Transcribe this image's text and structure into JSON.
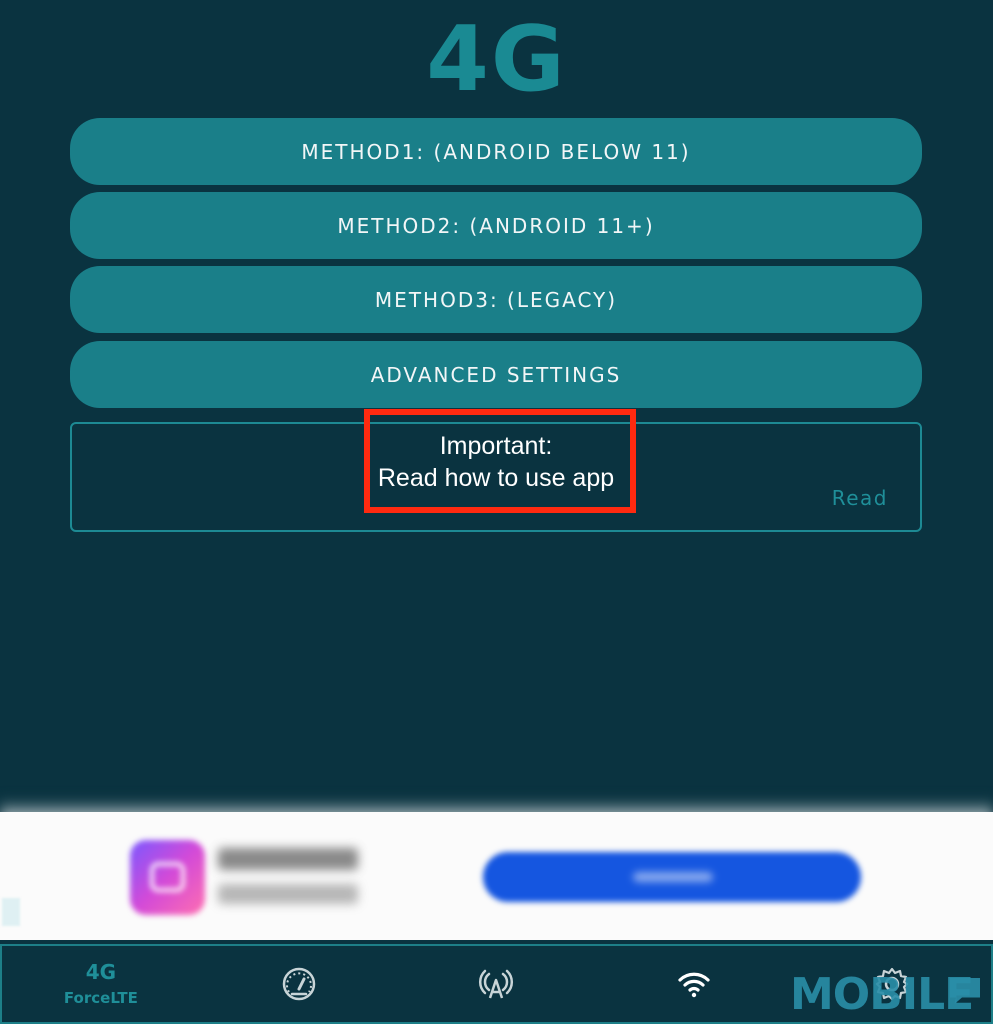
{
  "header": {
    "logo_text": "4G"
  },
  "methods": [
    {
      "label": "METHOD1: (ANDROID BELOW 11)"
    },
    {
      "label": "METHOD2: (ANDROID 11+)"
    },
    {
      "label": "METHOD3: (LEGACY)"
    },
    {
      "label": "ADVANCED SETTINGS"
    }
  ],
  "info_card": {
    "title": "Important:",
    "body": "Read how to use app",
    "action_label": "Read"
  },
  "ad": {
    "note": ""
  },
  "bottom_nav": {
    "items": [
      {
        "icon": "4g-icon",
        "icon_text": "4G",
        "label": "ForceLTE",
        "active": true
      },
      {
        "icon": "speedometer-icon"
      },
      {
        "icon": "antenna-icon"
      },
      {
        "icon": "wifi-icon"
      },
      {
        "icon": "gear-icon"
      }
    ]
  },
  "watermark": {
    "text": "MOBILE"
  },
  "colors": {
    "background": "#0a3340",
    "button": "#1a7f89",
    "accent": "#1f8f99",
    "highlight": "#ff2a10"
  }
}
